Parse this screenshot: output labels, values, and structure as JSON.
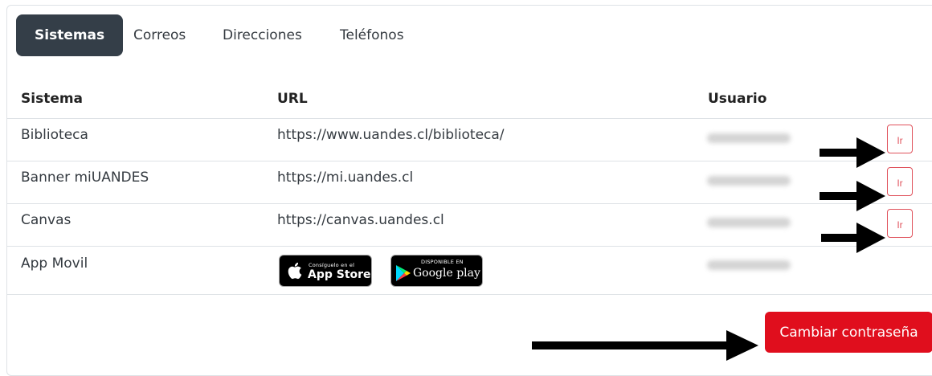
{
  "tabs": [
    {
      "label": "Sistemas",
      "active": true
    },
    {
      "label": "Correos",
      "active": false
    },
    {
      "label": "Direcciones",
      "active": false
    },
    {
      "label": "Teléfonos",
      "active": false
    }
  ],
  "table": {
    "headers": [
      "Sistema",
      "URL",
      "Usuario"
    ],
    "rows": [
      {
        "sistema": "Biblioteca",
        "url": "https://www.uandes.cl/biblioteca/",
        "action": "Ir"
      },
      {
        "sistema": "Banner miUANDES",
        "url": "https://mi.uandes.cl",
        "action": "Ir"
      },
      {
        "sistema": "Canvas",
        "url": "https://canvas.uandes.cl",
        "action": "Ir"
      },
      {
        "sistema": "App Movil",
        "url": "",
        "action": ""
      }
    ]
  },
  "badges": {
    "appstore": {
      "small": "Consíguelo en el",
      "big": "App Store"
    },
    "googleplay": {
      "small": "DISPONIBLE EN",
      "big": "Google play"
    }
  },
  "primary_button": "Cambiar contraseña",
  "colors": {
    "tab_active": "#343e48",
    "danger": "#e00e1d",
    "outline": "#e0525c"
  }
}
